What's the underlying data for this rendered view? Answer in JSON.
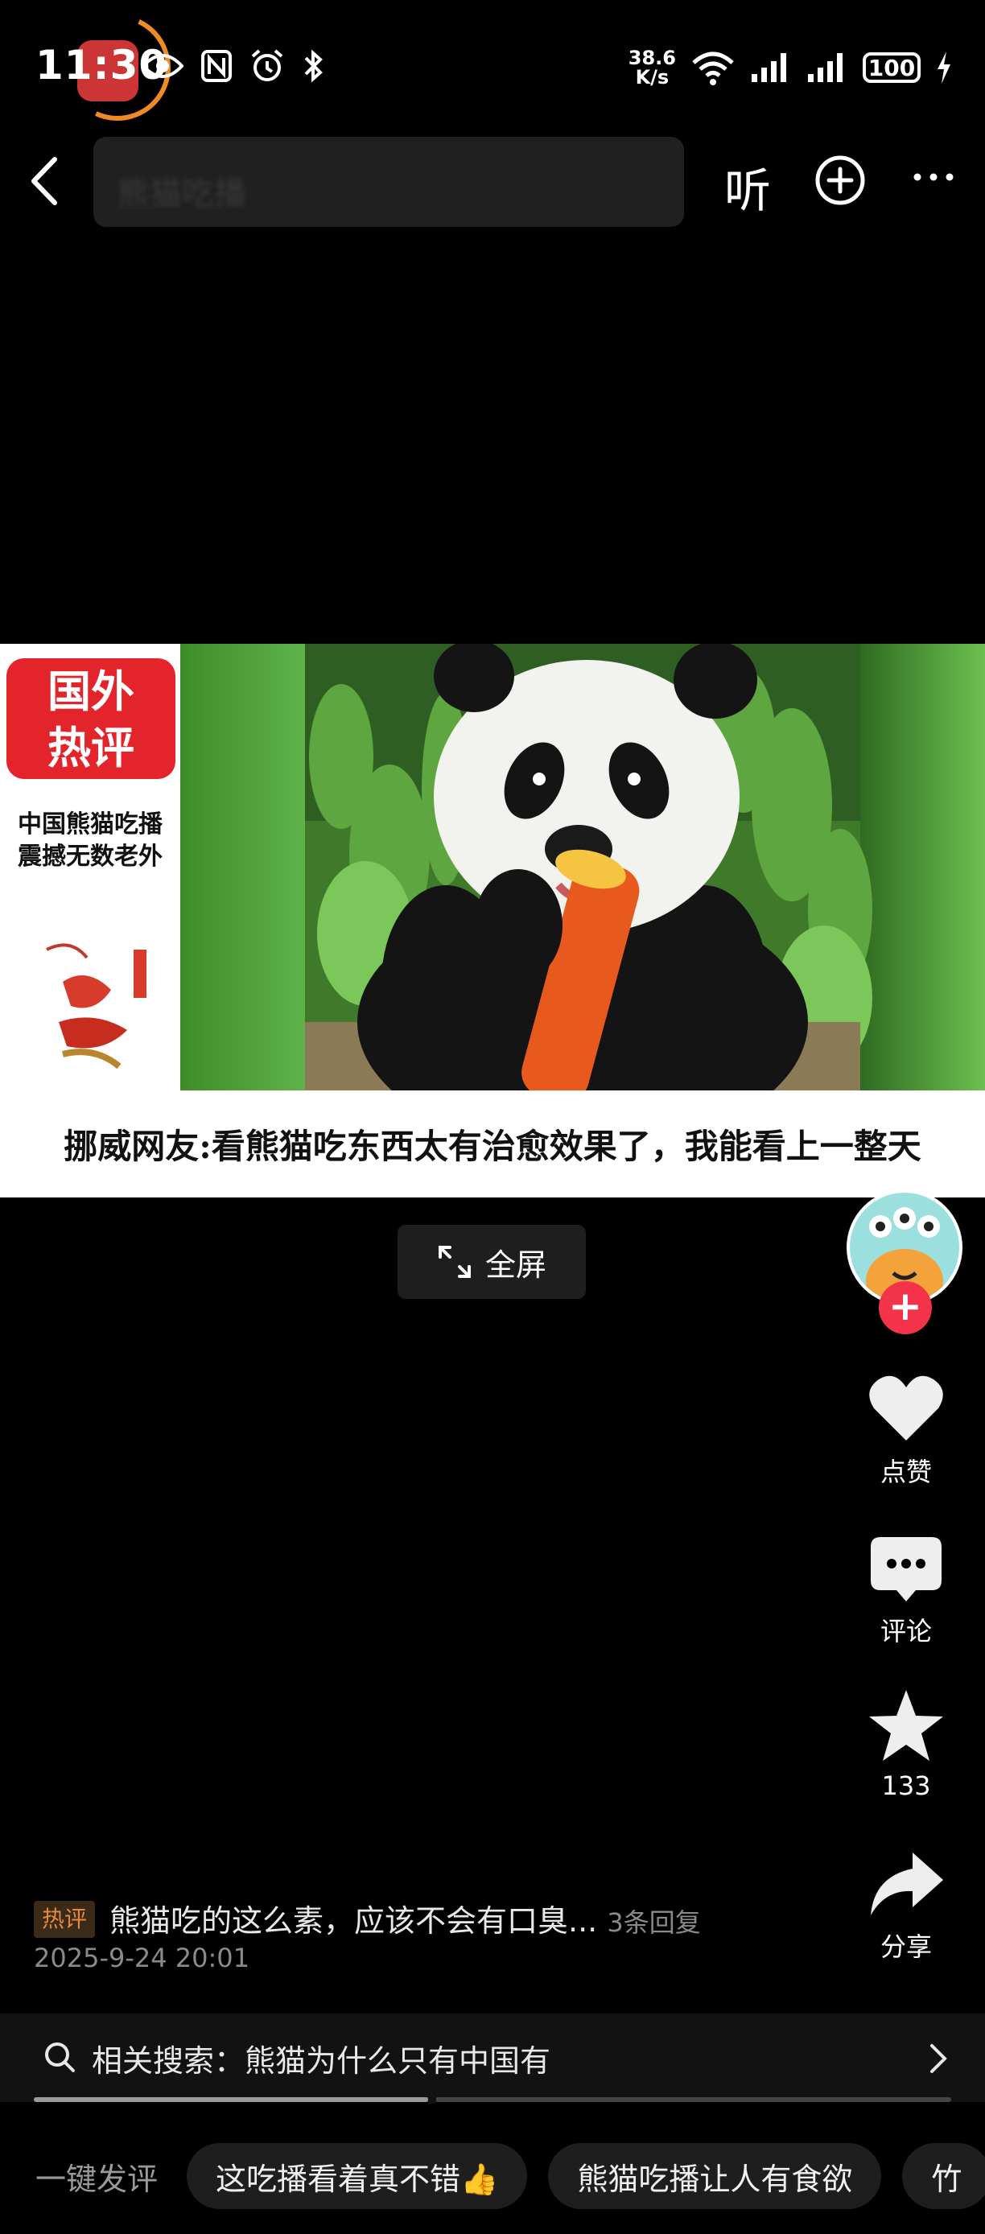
{
  "status_bar": {
    "time": "11:30",
    "net_speed_value": "38.6",
    "net_speed_unit": "K/s",
    "battery": "100"
  },
  "nav": {
    "search_placeholder": "熊猫吃播",
    "listen_label": "听"
  },
  "video": {
    "promo_logo_line1": "国外",
    "promo_logo_line2": "热评",
    "promo_sub_line1": "中国熊猫吃播",
    "promo_sub_line2": "震撼无数老外",
    "caption": "挪威网友:看熊猫吃东西太有治愈效果了，我能看上一整天"
  },
  "fullscreen_label": "全屏",
  "rail": {
    "like_label": "点赞",
    "comment_label": "评论",
    "favorite_count": "133",
    "share_label": "分享"
  },
  "comment": {
    "tag": "热评",
    "text": "熊猫吃的这么素，应该不会有口臭...",
    "replies": "3条回复",
    "time": "2025-9-24 20:01"
  },
  "related": {
    "text": "相关搜索：熊猫为什么只有中国有",
    "progress": 0.43
  },
  "quick_comment": {
    "label": "一键发评",
    "chips": [
      "这吃播看着真不错👍",
      "熊猫吃播让人有食欲",
      "竹"
    ]
  },
  "colors": {
    "accent_red": "#f2334a",
    "hot_tag_orange": "#e5893a",
    "background": "#000000"
  }
}
